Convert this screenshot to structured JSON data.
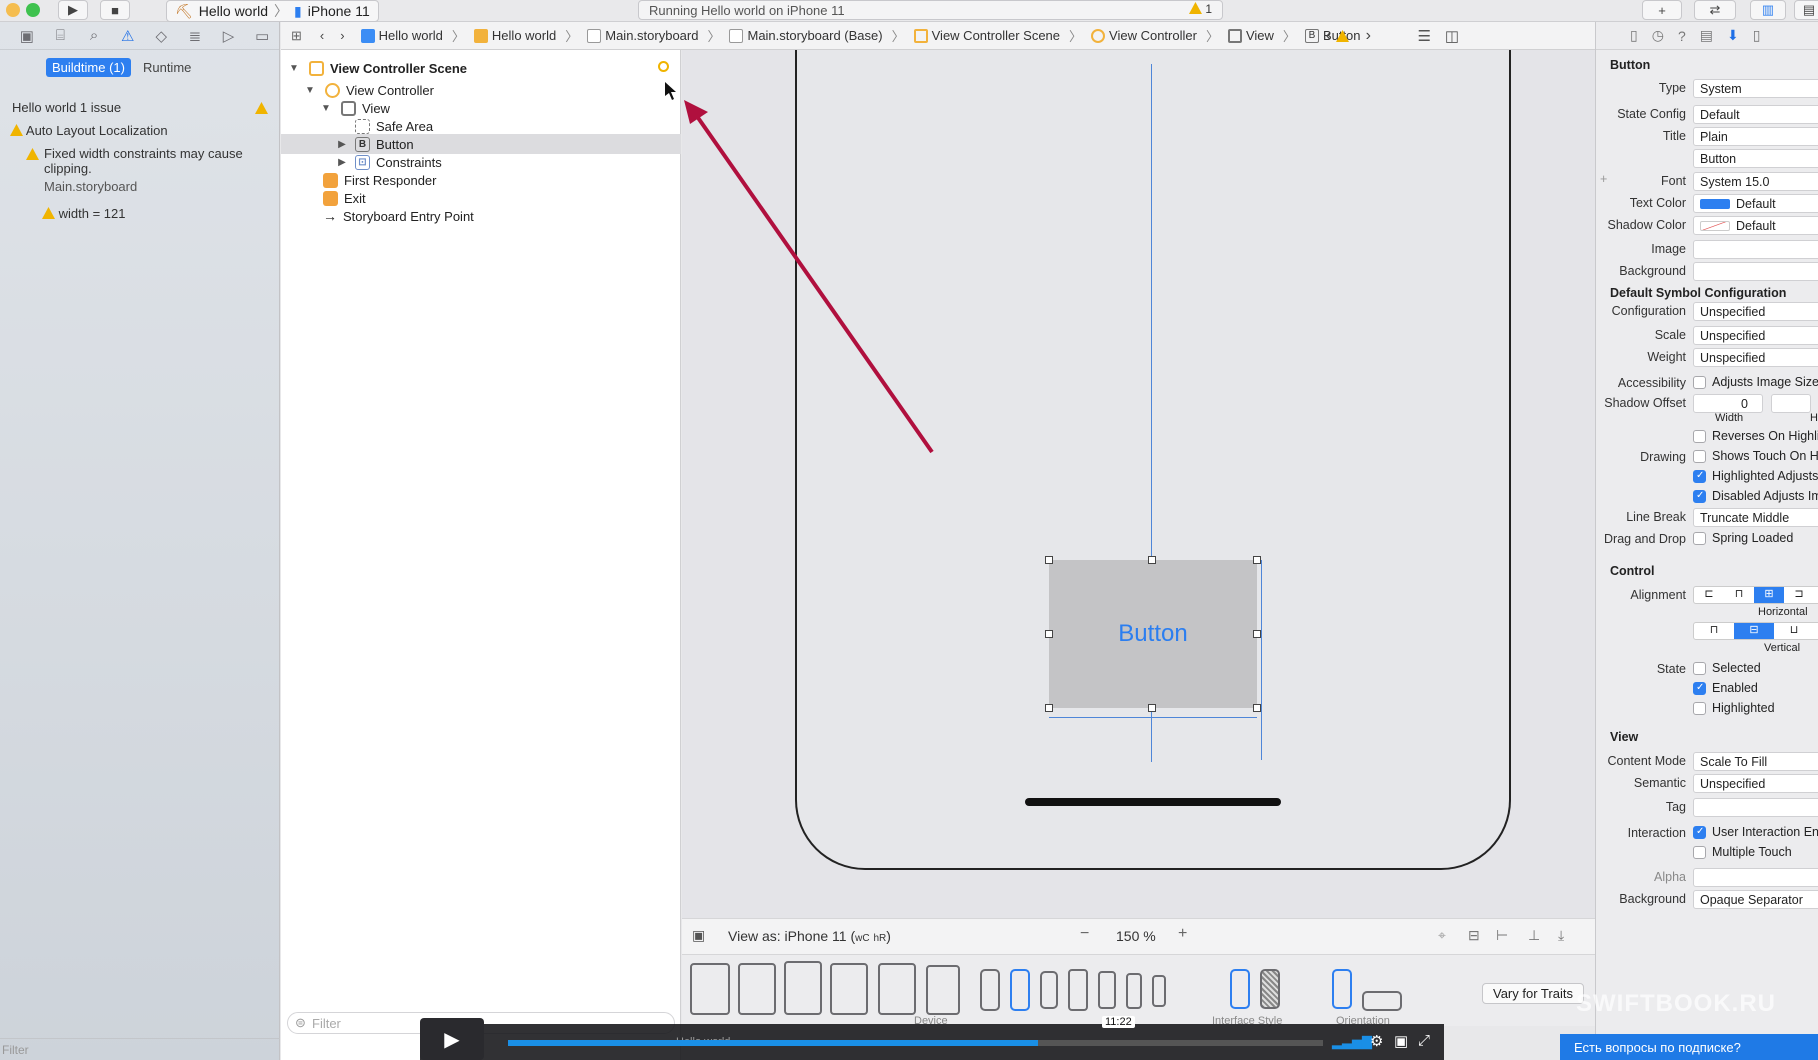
{
  "toolbar": {
    "scheme_project": "Hello world",
    "scheme_device": "iPhone 11",
    "activity_text": "Running Hello world on iPhone 11",
    "activity_warnings": "1"
  },
  "navigator": {
    "tab_buildtime": "Buildtime (1)",
    "tab_runtime": "Runtime",
    "issue_project": "Hello world 1 issue",
    "issue_group": "Auto Layout Localization",
    "issue_message": "Fixed width constraints may cause clipping.",
    "issue_file": "Main.storyboard",
    "issue_detail": "width = 121",
    "filter_placeholder": "Filter"
  },
  "jumpbar": {
    "crumbs": [
      "Hello world",
      "Hello world",
      "Main.storyboard",
      "Main.storyboard (Base)",
      "View Controller Scene",
      "View Controller",
      "View",
      "Button"
    ]
  },
  "outline": {
    "scene": "View Controller Scene",
    "view_controller": "View Controller",
    "view": "View",
    "safe_area": "Safe Area",
    "button": "Button",
    "constraints": "Constraints",
    "first_responder": "First Responder",
    "exit": "Exit",
    "entry_point": "Storyboard Entry Point",
    "filter_placeholder": "Filter"
  },
  "canvas": {
    "button_title": "Button",
    "view_as": "View as: iPhone 11 (",
    "size_class_w": "wC",
    "size_class_h": "hR",
    "view_as_close": ")",
    "zoom": "150 %",
    "device_label": "Device",
    "interface_style_label": "Interface Style",
    "orientation_label": "Orientation",
    "vary_for_traits": "Vary for Traits"
  },
  "inspector": {
    "section_button": "Button",
    "type_label": "Type",
    "type_value": "System",
    "state_config_label": "State Config",
    "state_config_value": "Default",
    "title_label": "Title",
    "title_value": "Plain",
    "title_text": "Button",
    "font_label": "Font",
    "font_value": "System 15.0",
    "text_color_label": "Text Color",
    "text_color_value": "Default",
    "shadow_color_label": "Shadow Color",
    "shadow_color_value": "Default",
    "image_label": "Image",
    "background_label": "Background",
    "section_symbol": "Default Symbol Configuration",
    "configuration_label": "Configuration",
    "configuration_value": "Unspecified",
    "scale_label": "Scale",
    "scale_value": "Unspecified",
    "weight_label": "Weight",
    "weight_value": "Unspecified",
    "accessibility_label": "Accessibility",
    "adjusts_image_size": "Adjusts Image Size",
    "shadow_offset_label": "Shadow Offset",
    "shadow_offset_width": "0",
    "width_caption": "Width",
    "height_caption": "Height",
    "reverses": "Reverses On Highlight",
    "drawing_label": "Drawing",
    "shows_touch": "Shows Touch On Highlight",
    "highlighted_adjusts": "Highlighted Adjusts Image",
    "disabled_adjusts": "Disabled Adjusts Image",
    "line_break_label": "Line Break",
    "line_break_value": "Truncate Middle",
    "drag_drop_label": "Drag and Drop",
    "spring_loaded": "Spring Loaded",
    "section_control": "Control",
    "alignment_label": "Alignment",
    "horizontal_caption": "Horizontal",
    "vertical_caption": "Vertical",
    "state_label": "State",
    "selected": "Selected",
    "enabled": "Enabled",
    "highlighted": "Highlighted",
    "section_view": "View",
    "content_mode_label": "Content Mode",
    "content_mode_value": "Scale To Fill",
    "semantic_label": "Semantic",
    "semantic_value": "Unspecified",
    "tag_label": "Tag",
    "interaction_label": "Interaction",
    "user_interaction": "User Interaction Enabled",
    "multiple_touch": "Multiple Touch",
    "alpha_label": "Alpha",
    "background2_label": "Background",
    "background2_value": "Opaque Separator"
  },
  "video": {
    "timestamp": "11:22",
    "progress": 0.65,
    "chat_text": "Есть вопросы по подписке?",
    "watermark": "SWIFTBOOK.RU",
    "scheme_footer": "Hello world"
  },
  "colors": {
    "accent": "#2d7ff0",
    "warning": "#f0b400",
    "annotation_arrow": "#b0103e"
  }
}
